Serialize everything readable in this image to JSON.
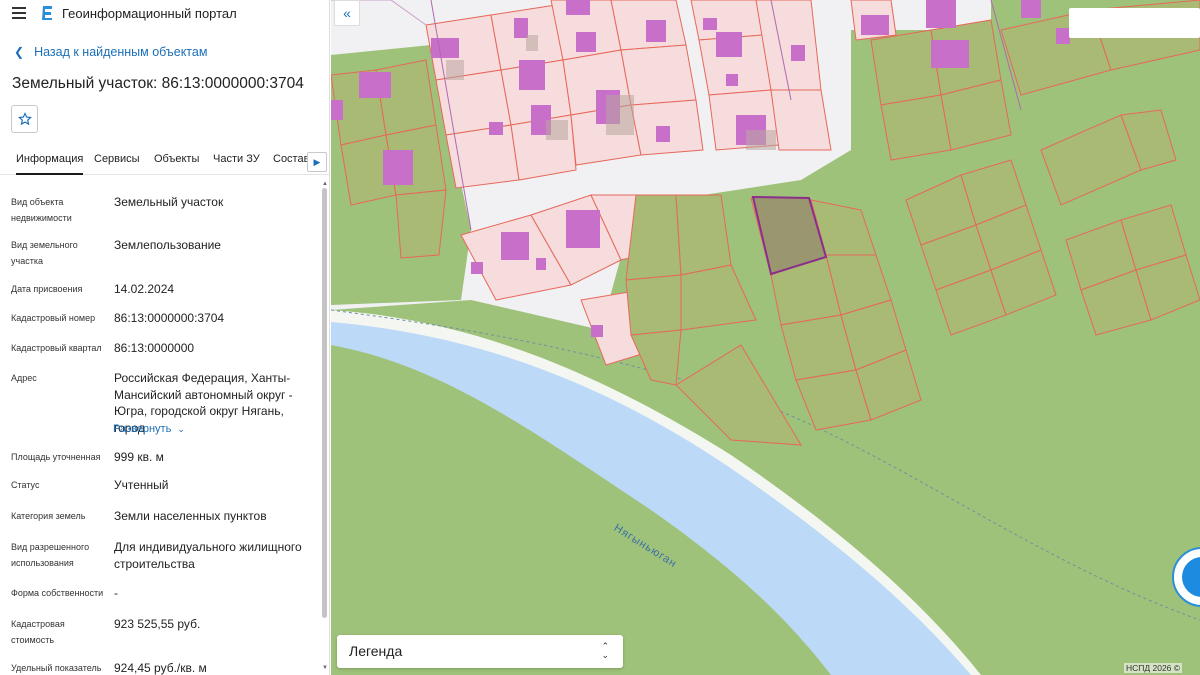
{
  "app": {
    "title": "Геоинформационный портал"
  },
  "nav": {
    "back_label": "Назад к найденным объектам"
  },
  "object": {
    "title": "Земельный участок: 86:13:0000000:3704"
  },
  "tabs": [
    "Информация",
    "Сервисы",
    "Объекты",
    "Части ЗУ",
    "Состав"
  ],
  "properties": [
    {
      "key": "Вид объекта недвижимости",
      "value": "Земельный участок"
    },
    {
      "key": "Вид земельного участка",
      "value": "Землепользование"
    },
    {
      "key": "Дата присвоения",
      "value": "14.02.2024"
    },
    {
      "key": "Кадастровый номер",
      "value": "86:13:0000000:3704"
    },
    {
      "key": "Кадастровый квартал",
      "value": "86:13:0000000"
    },
    {
      "key": "Адрес",
      "value": "Российская Федерация, Ханты-Мансийский автономный округ - Югра, городской округ Нягань, город"
    },
    {
      "key": "Площадь уточненная",
      "value": "999 кв. м"
    },
    {
      "key": "Статус",
      "value": "Учтенный"
    },
    {
      "key": "Категория земель",
      "value": "Земли населенных пунктов"
    },
    {
      "key": "Вид разрешенного использования",
      "value": "Для индивидуального жилищного строительства"
    },
    {
      "key": "Форма собственности",
      "value": "-"
    },
    {
      "key": "Кадастровая стоимость",
      "value": "923 525,55 руб."
    },
    {
      "key": "Удельный показатель",
      "value": "924,45 руб./кв. м"
    }
  ],
  "expand_label": "Развернуть",
  "map": {
    "legend_label": "Легенда",
    "river_name": "Нягыньюган",
    "copyright": "НСПД 2026 ©"
  },
  "colors": {
    "accent": "#1c6fb8",
    "parcel_fill": "#a8ba73",
    "building_fill": "#c76fc9",
    "water": "#bcd9f7",
    "selected_outline": "#8a2f8a"
  }
}
